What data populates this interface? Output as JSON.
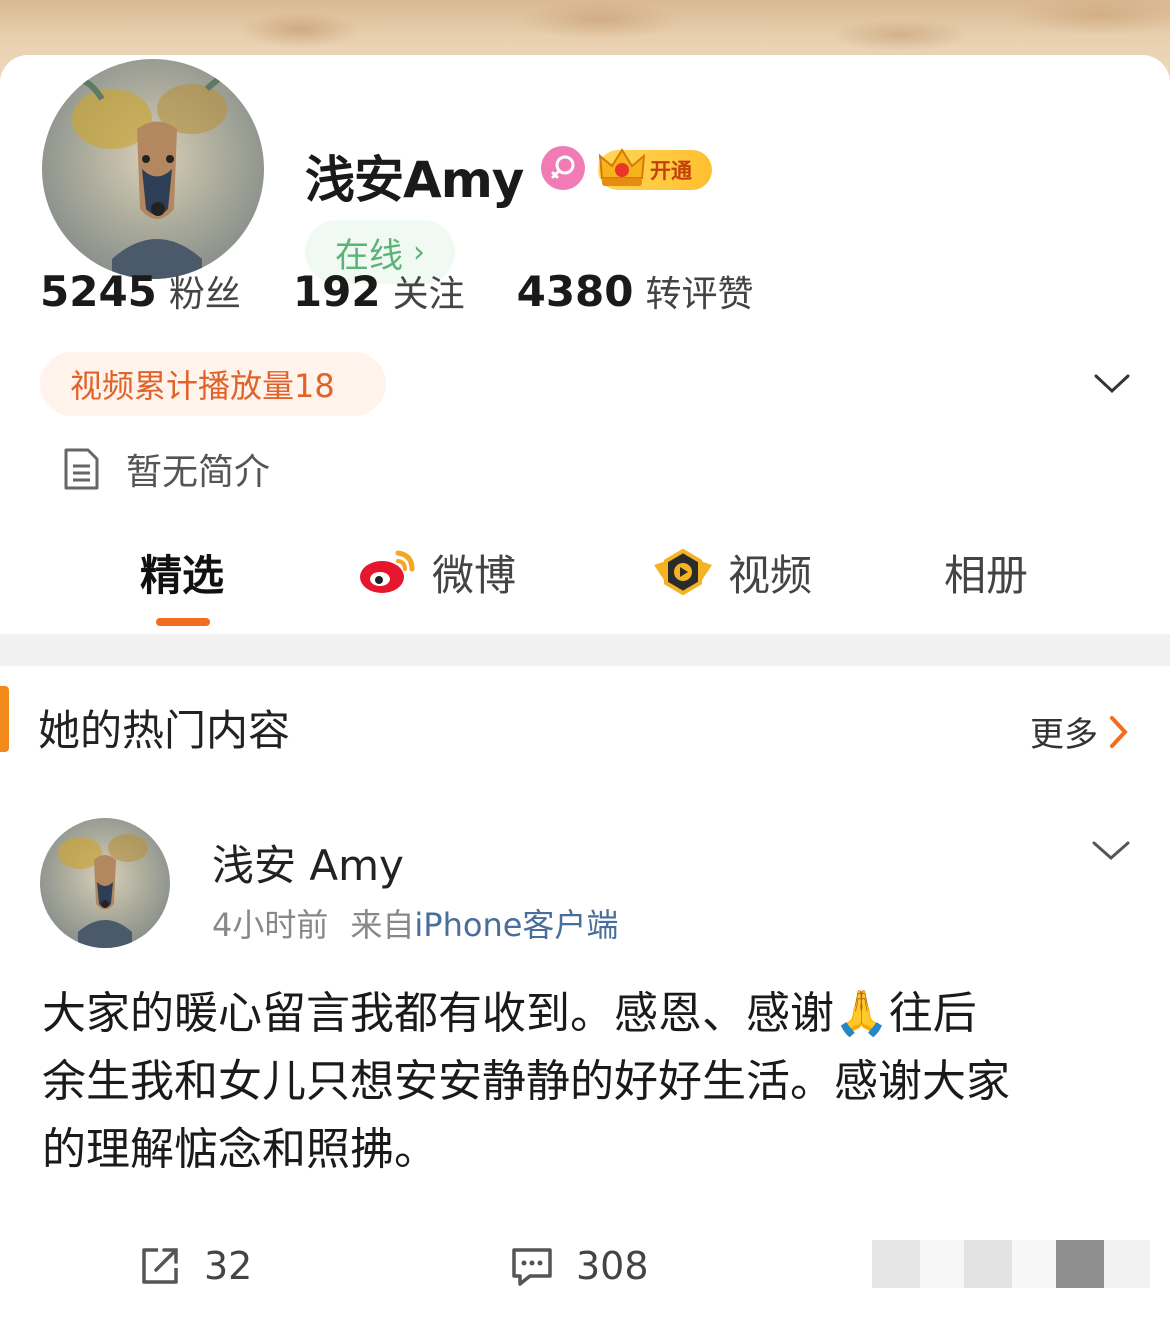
{
  "profile": {
    "name": "浅安Amy",
    "vip_label": "开通",
    "online_label": "在线",
    "stats": [
      {
        "value": "5245",
        "label": "粉丝"
      },
      {
        "value": "192",
        "label": "关注"
      },
      {
        "value": "4380",
        "label": "转评赞"
      }
    ],
    "video_chip": "视频累计播放量18",
    "bio": "暂无简介"
  },
  "tabs": [
    {
      "label": "精选",
      "active": true
    },
    {
      "label": "微博"
    },
    {
      "label": "视频"
    },
    {
      "label": "相册"
    }
  ],
  "section": {
    "title": "她的热门内容",
    "more_label": "更多"
  },
  "post": {
    "author": "浅安 Amy",
    "time": "4小时前",
    "source_prefix": "来自",
    "source_client": "iPhone客户端",
    "body_line1": "大家的暖心留言我都有收到。感恩、感谢🙏往后",
    "body_line2": "余生我和女儿只想安安静静的好好生活。感谢大家",
    "body_line3": "的理解惦念和照拂。",
    "reposts": "32",
    "comments": "308"
  },
  "colors": {
    "accent_orange": "#f26d1d",
    "online_green": "#5cb377",
    "link_blue": "#4a6e9a"
  }
}
